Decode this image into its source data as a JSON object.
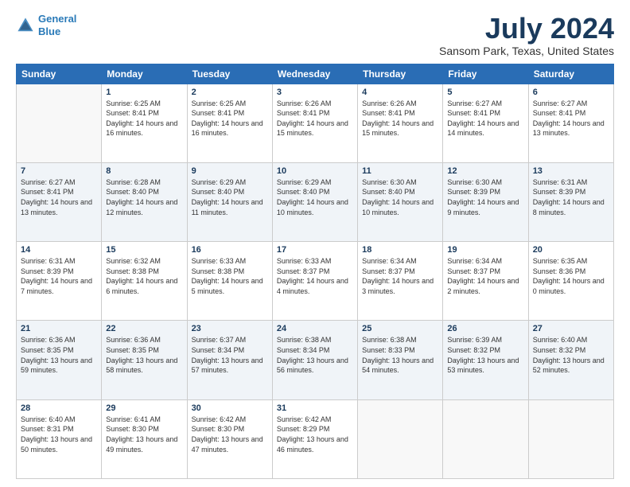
{
  "header": {
    "logo_line1": "General",
    "logo_line2": "Blue",
    "title": "July 2024",
    "subtitle": "Sansom Park, Texas, United States"
  },
  "days_of_week": [
    "Sunday",
    "Monday",
    "Tuesday",
    "Wednesday",
    "Thursday",
    "Friday",
    "Saturday"
  ],
  "weeks": [
    [
      {
        "num": "",
        "empty": true
      },
      {
        "num": "1",
        "sunrise": "Sunrise: 6:25 AM",
        "sunset": "Sunset: 8:41 PM",
        "daylight": "Daylight: 14 hours and 16 minutes."
      },
      {
        "num": "2",
        "sunrise": "Sunrise: 6:25 AM",
        "sunset": "Sunset: 8:41 PM",
        "daylight": "Daylight: 14 hours and 16 minutes."
      },
      {
        "num": "3",
        "sunrise": "Sunrise: 6:26 AM",
        "sunset": "Sunset: 8:41 PM",
        "daylight": "Daylight: 14 hours and 15 minutes."
      },
      {
        "num": "4",
        "sunrise": "Sunrise: 6:26 AM",
        "sunset": "Sunset: 8:41 PM",
        "daylight": "Daylight: 14 hours and 15 minutes."
      },
      {
        "num": "5",
        "sunrise": "Sunrise: 6:27 AM",
        "sunset": "Sunset: 8:41 PM",
        "daylight": "Daylight: 14 hours and 14 minutes."
      },
      {
        "num": "6",
        "sunrise": "Sunrise: 6:27 AM",
        "sunset": "Sunset: 8:41 PM",
        "daylight": "Daylight: 14 hours and 13 minutes."
      }
    ],
    [
      {
        "num": "7",
        "sunrise": "Sunrise: 6:27 AM",
        "sunset": "Sunset: 8:41 PM",
        "daylight": "Daylight: 14 hours and 13 minutes."
      },
      {
        "num": "8",
        "sunrise": "Sunrise: 6:28 AM",
        "sunset": "Sunset: 8:40 PM",
        "daylight": "Daylight: 14 hours and 12 minutes."
      },
      {
        "num": "9",
        "sunrise": "Sunrise: 6:29 AM",
        "sunset": "Sunset: 8:40 PM",
        "daylight": "Daylight: 14 hours and 11 minutes."
      },
      {
        "num": "10",
        "sunrise": "Sunrise: 6:29 AM",
        "sunset": "Sunset: 8:40 PM",
        "daylight": "Daylight: 14 hours and 10 minutes."
      },
      {
        "num": "11",
        "sunrise": "Sunrise: 6:30 AM",
        "sunset": "Sunset: 8:40 PM",
        "daylight": "Daylight: 14 hours and 10 minutes."
      },
      {
        "num": "12",
        "sunrise": "Sunrise: 6:30 AM",
        "sunset": "Sunset: 8:39 PM",
        "daylight": "Daylight: 14 hours and 9 minutes."
      },
      {
        "num": "13",
        "sunrise": "Sunrise: 6:31 AM",
        "sunset": "Sunset: 8:39 PM",
        "daylight": "Daylight: 14 hours and 8 minutes."
      }
    ],
    [
      {
        "num": "14",
        "sunrise": "Sunrise: 6:31 AM",
        "sunset": "Sunset: 8:39 PM",
        "daylight": "Daylight: 14 hours and 7 minutes."
      },
      {
        "num": "15",
        "sunrise": "Sunrise: 6:32 AM",
        "sunset": "Sunset: 8:38 PM",
        "daylight": "Daylight: 14 hours and 6 minutes."
      },
      {
        "num": "16",
        "sunrise": "Sunrise: 6:33 AM",
        "sunset": "Sunset: 8:38 PM",
        "daylight": "Daylight: 14 hours and 5 minutes."
      },
      {
        "num": "17",
        "sunrise": "Sunrise: 6:33 AM",
        "sunset": "Sunset: 8:37 PM",
        "daylight": "Daylight: 14 hours and 4 minutes."
      },
      {
        "num": "18",
        "sunrise": "Sunrise: 6:34 AM",
        "sunset": "Sunset: 8:37 PM",
        "daylight": "Daylight: 14 hours and 3 minutes."
      },
      {
        "num": "19",
        "sunrise": "Sunrise: 6:34 AM",
        "sunset": "Sunset: 8:37 PM",
        "daylight": "Daylight: 14 hours and 2 minutes."
      },
      {
        "num": "20",
        "sunrise": "Sunrise: 6:35 AM",
        "sunset": "Sunset: 8:36 PM",
        "daylight": "Daylight: 14 hours and 0 minutes."
      }
    ],
    [
      {
        "num": "21",
        "sunrise": "Sunrise: 6:36 AM",
        "sunset": "Sunset: 8:35 PM",
        "daylight": "Daylight: 13 hours and 59 minutes."
      },
      {
        "num": "22",
        "sunrise": "Sunrise: 6:36 AM",
        "sunset": "Sunset: 8:35 PM",
        "daylight": "Daylight: 13 hours and 58 minutes."
      },
      {
        "num": "23",
        "sunrise": "Sunrise: 6:37 AM",
        "sunset": "Sunset: 8:34 PM",
        "daylight": "Daylight: 13 hours and 57 minutes."
      },
      {
        "num": "24",
        "sunrise": "Sunrise: 6:38 AM",
        "sunset": "Sunset: 8:34 PM",
        "daylight": "Daylight: 13 hours and 56 minutes."
      },
      {
        "num": "25",
        "sunrise": "Sunrise: 6:38 AM",
        "sunset": "Sunset: 8:33 PM",
        "daylight": "Daylight: 13 hours and 54 minutes."
      },
      {
        "num": "26",
        "sunrise": "Sunrise: 6:39 AM",
        "sunset": "Sunset: 8:32 PM",
        "daylight": "Daylight: 13 hours and 53 minutes."
      },
      {
        "num": "27",
        "sunrise": "Sunrise: 6:40 AM",
        "sunset": "Sunset: 8:32 PM",
        "daylight": "Daylight: 13 hours and 52 minutes."
      }
    ],
    [
      {
        "num": "28",
        "sunrise": "Sunrise: 6:40 AM",
        "sunset": "Sunset: 8:31 PM",
        "daylight": "Daylight: 13 hours and 50 minutes."
      },
      {
        "num": "29",
        "sunrise": "Sunrise: 6:41 AM",
        "sunset": "Sunset: 8:30 PM",
        "daylight": "Daylight: 13 hours and 49 minutes."
      },
      {
        "num": "30",
        "sunrise": "Sunrise: 6:42 AM",
        "sunset": "Sunset: 8:30 PM",
        "daylight": "Daylight: 13 hours and 47 minutes."
      },
      {
        "num": "31",
        "sunrise": "Sunrise: 6:42 AM",
        "sunset": "Sunset: 8:29 PM",
        "daylight": "Daylight: 13 hours and 46 minutes."
      },
      {
        "num": "",
        "empty": true
      },
      {
        "num": "",
        "empty": true
      },
      {
        "num": "",
        "empty": true
      }
    ]
  ]
}
